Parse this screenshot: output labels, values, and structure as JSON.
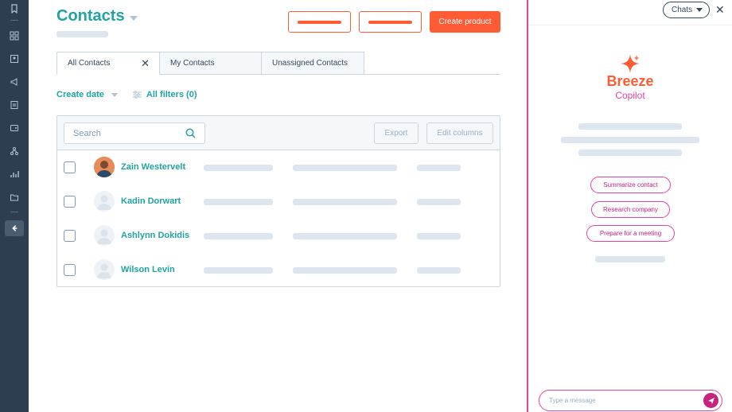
{
  "header": {
    "title": "Contacts",
    "create_button": "Create product"
  },
  "tabs": [
    {
      "label": "All Contacts",
      "close": "✕"
    },
    {
      "label": "My Contacts"
    },
    {
      "label": "Unassigned Contacts"
    }
  ],
  "filters": {
    "create_date": "Create date",
    "all_filters": "All filters (0)"
  },
  "table": {
    "search_placeholder": "Search",
    "export_label": "Export",
    "edit_columns_label": "Edit columns",
    "rows": [
      {
        "name": "Zain Westervelt"
      },
      {
        "name": "Kadin Dorwart"
      },
      {
        "name": "Ashlynn Dokidis"
      },
      {
        "name": "Wilson Levin"
      }
    ]
  },
  "copilot": {
    "chats_label": "Chats",
    "close": "✕",
    "brand": "Breeze",
    "product": "Copilot",
    "actions": [
      "Summarize contact",
      "Research company",
      "Prepare for a meeting"
    ],
    "input_placeholder": "Type a message"
  },
  "colors": {
    "accent_teal": "#1fa3a3",
    "primary_orange": "#ff5c35",
    "copilot_magenta": "#e8439a",
    "nav_dark": "#2d3e50"
  }
}
